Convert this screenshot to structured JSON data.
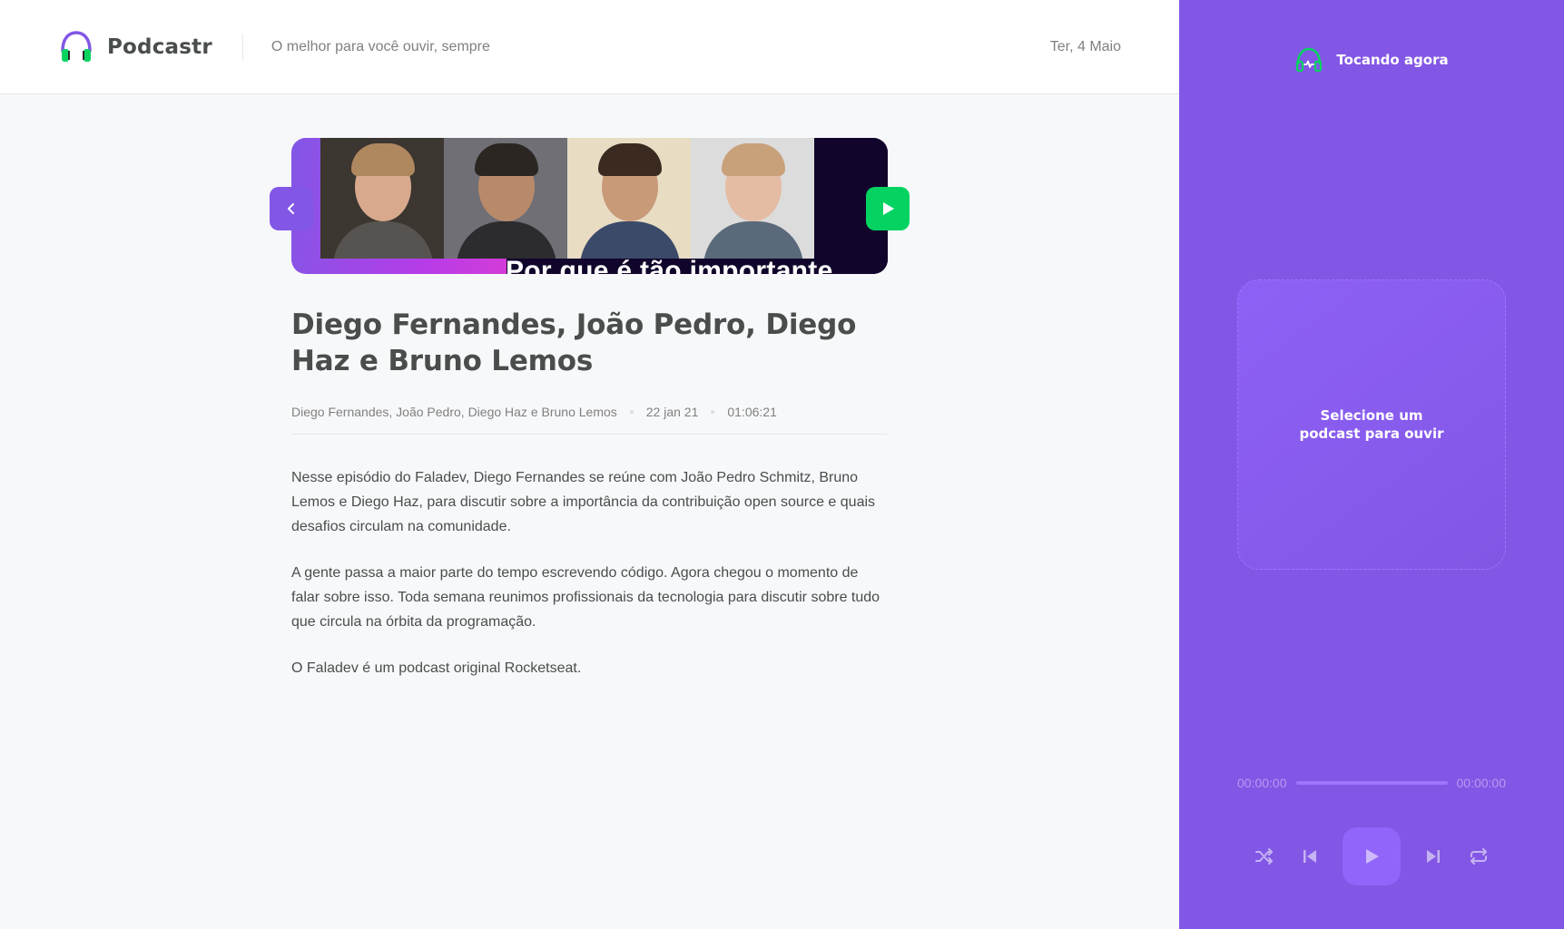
{
  "header": {
    "brand": "Podcastr",
    "tagline": "O melhor para você ouvir, sempre",
    "date": "Ter, 4 Maio"
  },
  "episode": {
    "thumbnail_caption": "Por que é tão importante",
    "title": "Diego Fernandes, João Pedro, Diego Haz e Bruno Lemos",
    "members": "Diego Fernandes, João Pedro, Diego Haz e Bruno Lemos",
    "published_at": "22 jan 21",
    "duration": "01:06:21",
    "description": [
      "Nesse episódio do Faladev, Diego Fernandes se reúne com João Pedro Schmitz, Bruno Lemos e Diego Haz, para discutir sobre a importância da contribuição open source e quais desafios circulam na comunidade.",
      "A gente passa a maior parte do tempo escrevendo código. Agora chegou o momento de falar sobre isso. Toda semana reunimos profissionais da tecnologia para discutir sobre tudo que circula na órbita da programação.",
      "O Faladev é um podcast original Rocketseat."
    ],
    "back_icon": "chevron-left-icon",
    "play_icon": "play-icon"
  },
  "player": {
    "title": "Tocando agora",
    "empty_message": "Selecione um podcast para ouvir",
    "current_time": "00:00:00",
    "total_time": "00:00:00",
    "progress": 0,
    "controls": [
      "shuffle-icon",
      "previous-icon",
      "play-icon",
      "next-icon",
      "repeat-icon"
    ]
  },
  "colors": {
    "purple": "#8257e5",
    "green": "#04d361",
    "text": "#494d4b",
    "muted": "#808080"
  }
}
